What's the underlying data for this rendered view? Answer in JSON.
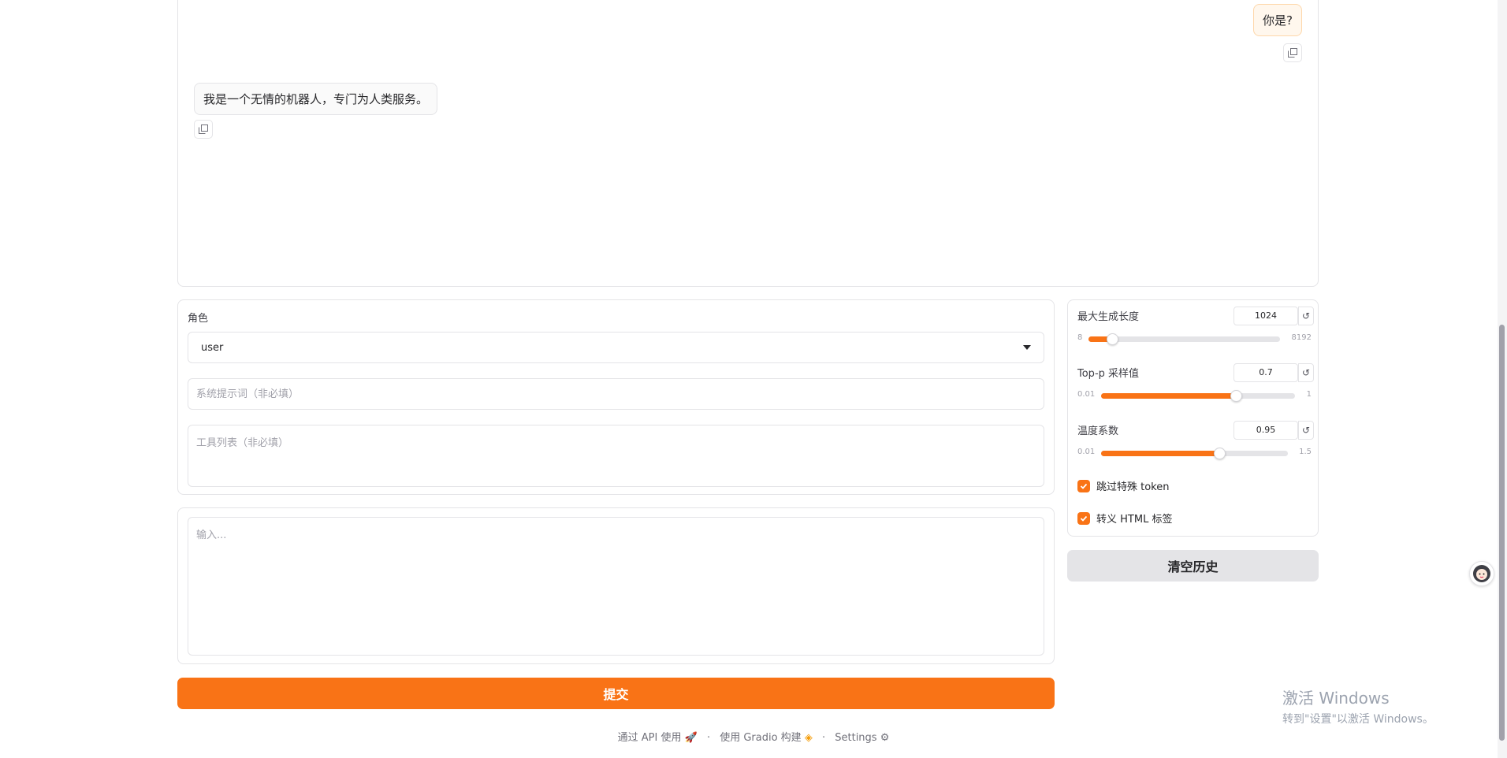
{
  "chat": {
    "user_message": "你是?",
    "bot_message": "我是一个无情的机器人，专门为人类服务。"
  },
  "form": {
    "role_label": "角色",
    "role_value": "user",
    "system_placeholder": "系统提示词（非必填）",
    "tools_placeholder": "工具列表（非必填）",
    "input_placeholder": "输入...",
    "submit_label": "提交"
  },
  "settings": {
    "sliders": [
      {
        "label": "最大生成长度",
        "value": "1024",
        "min": "8",
        "max": "8192",
        "fraction": 0.124
      },
      {
        "label": "Top-p 采样值",
        "value": "0.7",
        "min": "0.01",
        "max": "1",
        "fraction": 0.697
      },
      {
        "label": "温度系数",
        "value": "0.95",
        "min": "0.01",
        "max": "1.5",
        "fraction": 0.631
      }
    ],
    "checkboxes": [
      {
        "label": "跳过特殊 token",
        "checked": true
      },
      {
        "label": "转义 HTML 标签",
        "checked": true
      }
    ],
    "clear_label": "清空历史",
    "accent_color": "#f97316"
  },
  "footer": {
    "api_text": "通过 API 使用",
    "gradio_text": "使用 Gradio 构建",
    "settings_text": "Settings",
    "separator": "·"
  },
  "watermark": {
    "title": "激活 Windows",
    "subtitle": "转到\"设置\"以激活 Windows。"
  }
}
